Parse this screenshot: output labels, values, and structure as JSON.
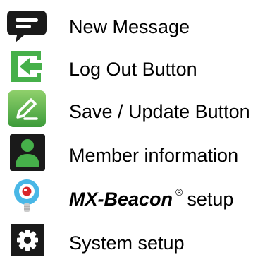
{
  "legend": {
    "items": [
      {
        "icon": "chat-bubble-icon",
        "label": "New Message"
      },
      {
        "icon": "logout-arrow-icon",
        "label": "Log Out Button"
      },
      {
        "icon": "edit-pencil-icon",
        "label": "Save / Update Button"
      },
      {
        "icon": "member-person-icon",
        "label": "Member information"
      },
      {
        "icon": "beacon-bulb-icon",
        "brand": "MX-Beacon",
        "reg": "®",
        "label": "setup"
      },
      {
        "icon": "gear-icon",
        "label": "System setup"
      }
    ]
  },
  "colors": {
    "black": "#1a1a1a",
    "green": "#46b04a",
    "green_light": "#8fd06b",
    "beacon_blue": "#49b7e6",
    "beacon_red": "#d9262a"
  }
}
